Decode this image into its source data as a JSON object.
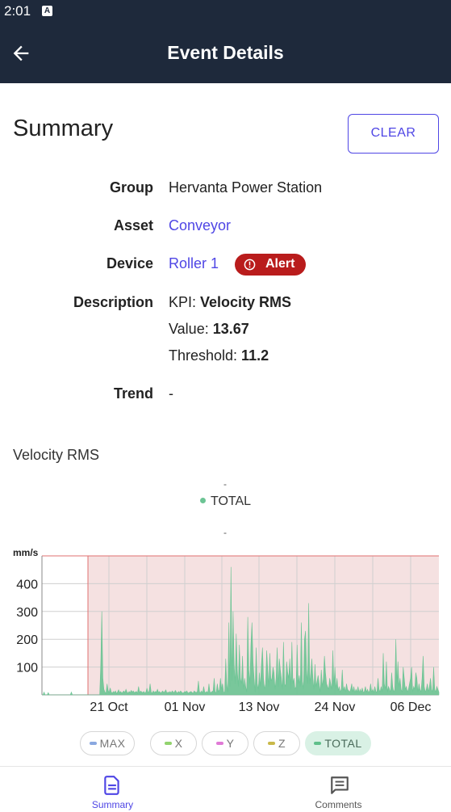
{
  "status_bar": {
    "time": "2:01",
    "notification_glyph": "A"
  },
  "app_bar": {
    "title": "Event Details",
    "back_icon": "arrow-left-icon"
  },
  "summary": {
    "title": "Summary",
    "clear_label": "CLEAR",
    "group_label": "Group",
    "group_value": "Hervanta Power Station",
    "asset_label": "Asset",
    "asset_value": "Conveyor",
    "device_label": "Device",
    "device_value": "Roller 1",
    "alert_label": "Alert",
    "description_label": "Description",
    "kpi_prefix": "KPI: ",
    "kpi_value": "Velocity RMS",
    "value_prefix": "Value: ",
    "value_value": "13.67",
    "threshold_prefix": "Threshold: ",
    "threshold_value": "11.2",
    "trend_label": "Trend",
    "trend_value": "-"
  },
  "chart": {
    "title": "Velocity RMS",
    "legend_dash_top": "-",
    "legend_dash_bottom": "-",
    "legend_item": "TOTAL",
    "series_toggles": [
      {
        "label": "MAX",
        "color": "#8aa8e0",
        "active": false
      },
      {
        "label": "X",
        "color": "#92d36e",
        "active": false
      },
      {
        "label": "Y",
        "color": "#e07ad6",
        "active": false
      },
      {
        "label": "Z",
        "color": "#c9b94a",
        "active": false
      },
      {
        "label": "TOTAL",
        "color": "#5fbf8a",
        "active": true
      }
    ]
  },
  "chart_data": {
    "type": "area",
    "ylabel": "mm/s",
    "y_ticks": [
      "100",
      "200",
      "300",
      "400"
    ],
    "x_ticks": [
      "21 Oct",
      "01 Nov",
      "13 Nov",
      "24 Nov",
      "06 Dec"
    ],
    "ylim": [
      0,
      500
    ],
    "threshold_note": "shaded alert region from 21 Oct onward",
    "colors": {
      "series": "#6cc494",
      "alert_region": "#f5e1e1",
      "alert_line": "#e07070"
    },
    "series": [
      {
        "values": [
          0,
          0,
          10,
          0,
          0,
          0,
          8,
          0,
          0,
          0,
          0,
          0,
          0,
          0,
          0,
          0,
          0,
          0,
          0,
          0,
          0,
          0,
          0,
          0,
          0,
          0,
          0,
          0,
          10,
          0,
          0,
          0,
          0,
          0,
          0,
          0,
          0,
          0,
          0,
          0,
          0,
          0,
          0,
          0,
          0,
          0,
          0,
          0,
          0,
          0,
          0,
          0,
          0,
          0,
          0,
          0,
          110,
          300,
          60,
          20,
          10,
          5,
          40,
          15,
          8,
          25,
          10,
          6,
          12,
          8,
          14,
          5,
          10,
          18,
          8,
          12,
          6,
          10,
          14,
          8,
          20,
          10,
          6,
          12,
          8,
          16,
          10,
          14,
          8,
          10,
          12,
          6,
          30,
          8,
          14,
          10,
          8,
          12,
          6,
          10,
          24,
          8,
          12,
          40,
          10,
          6,
          14,
          8,
          12,
          10,
          20,
          8,
          12,
          6,
          10,
          14,
          8,
          12,
          18,
          6,
          10,
          8,
          12,
          6,
          14,
          10,
          8,
          16,
          10,
          6,
          12,
          8,
          14,
          10,
          6,
          8,
          12,
          10,
          14,
          6,
          8,
          10,
          12,
          8,
          6,
          14,
          10,
          8,
          12,
          50,
          10,
          8,
          14,
          6,
          30,
          10,
          8,
          12,
          6,
          40,
          10,
          8,
          12,
          14,
          60,
          8,
          10,
          40,
          12,
          18,
          60,
          20,
          40,
          10,
          8,
          130,
          40,
          10,
          260,
          30,
          460,
          50,
          300,
          110,
          40,
          220,
          90,
          30,
          180,
          60,
          40,
          140,
          20,
          60,
          30,
          10,
          280,
          90,
          40,
          180,
          260,
          120,
          60,
          10,
          170,
          40,
          20,
          80,
          30,
          110,
          170,
          60,
          20,
          40,
          160,
          90,
          30,
          150,
          50,
          60,
          100,
          80,
          20,
          60,
          170,
          30,
          130,
          90,
          60,
          20,
          190,
          40,
          30,
          120,
          80,
          60,
          130,
          20,
          190,
          40,
          60,
          20,
          30,
          180,
          40,
          70,
          30,
          260,
          50,
          20,
          200,
          230,
          90,
          40,
          330,
          40,
          80,
          130,
          60,
          20,
          110,
          30,
          50,
          70,
          40,
          10,
          90,
          30,
          60,
          140,
          80,
          40,
          30,
          20,
          60,
          40,
          20,
          160,
          30,
          100,
          20,
          60,
          15,
          30,
          10,
          20,
          90,
          15,
          30,
          10,
          40,
          20,
          15,
          10,
          20,
          40,
          10,
          30,
          8,
          20,
          10,
          30,
          8,
          20,
          10,
          25,
          8,
          12,
          30,
          10,
          20,
          8,
          15,
          40,
          10,
          20,
          8,
          30,
          12,
          10,
          60,
          20,
          10,
          30,
          10,
          150,
          40,
          20,
          120,
          10,
          30,
          20,
          10,
          80,
          30,
          10,
          20,
          200,
          40,
          120,
          30,
          60,
          20,
          10,
          100,
          60,
          20,
          30,
          10,
          20,
          40,
          60,
          100,
          10,
          30,
          20,
          80,
          60,
          10,
          40,
          20,
          10,
          60,
          140,
          30,
          10,
          20,
          40,
          10,
          30,
          60,
          20,
          10,
          100,
          20,
          10,
          30,
          20,
          10
        ]
      }
    ]
  },
  "bottom_nav": [
    {
      "label": "Summary",
      "icon": "document-icon",
      "active": true
    },
    {
      "label": "Comments",
      "icon": "comment-icon",
      "active": false
    }
  ]
}
